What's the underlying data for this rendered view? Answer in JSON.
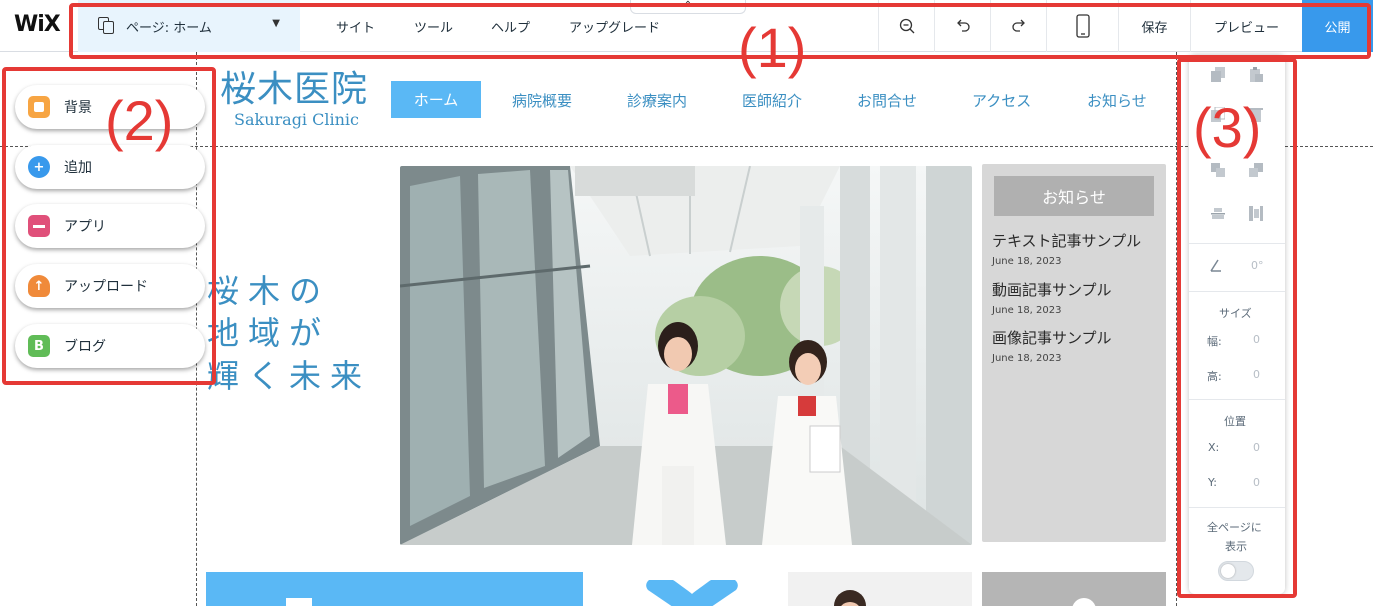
{
  "app": {
    "logo": "WiX"
  },
  "topbar": {
    "page_select": "ページ: ホーム",
    "menu": [
      "サイト",
      "ツール",
      "ヘルプ",
      "アップグレード"
    ],
    "save": "保存",
    "preview": "プレビュー",
    "publish": "公開"
  },
  "site": {
    "title": "桜木医院",
    "subtitle": "Sakuragi Clinic",
    "nav_active": "ホーム",
    "nav": [
      "病院概要",
      "診療案内",
      "医師紹介",
      "お問合せ",
      "アクセス",
      "お知らせ"
    ],
    "hero_lines": [
      "桜木の",
      "地域が",
      "輝く未来"
    ]
  },
  "news": {
    "button": "お知らせ",
    "items": [
      {
        "title": "テキスト記事サンプル",
        "date": "June 18, 2023"
      },
      {
        "title": "動画記事サンプル",
        "date": "June 18, 2023"
      },
      {
        "title": "画像記事サンプル",
        "date": "June 18, 2023"
      }
    ]
  },
  "left_panel": [
    {
      "label": "背景",
      "icon": "background-icon",
      "color": "#f7a543"
    },
    {
      "label": "追加",
      "icon": "plus-icon",
      "color": "#3899ec"
    },
    {
      "label": "アプリ",
      "icon": "store-icon",
      "color": "#e0507a"
    },
    {
      "label": "アップロード",
      "icon": "upload-cloud-icon",
      "color": "#f08a3a"
    },
    {
      "label": "ブログ",
      "icon": "blog-icon",
      "color": "#60bc57",
      "icon_letter": "B"
    }
  ],
  "inspector": {
    "angle": "0°",
    "size_title": "サイズ",
    "width_label": "幅:",
    "width_value": "0",
    "height_label": "高:",
    "height_value": "0",
    "position_title": "位置",
    "x_label": "X:",
    "x_value": "0",
    "y_label": "Y:",
    "y_value": "0",
    "show_all_line1": "全ページに",
    "show_all_line2": "表示"
  },
  "annotations": [
    "(1)",
    "(2)",
    "(3)"
  ],
  "colors": {
    "accent": "#3899ec",
    "site_blue": "#3b8fc2",
    "nav_active": "#5ab8f5",
    "annotation_red": "#e53935"
  }
}
